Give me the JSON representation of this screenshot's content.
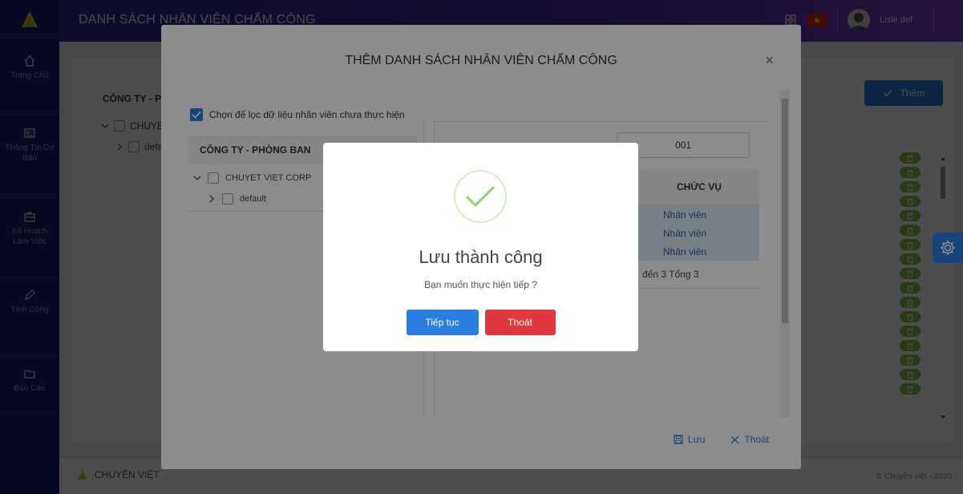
{
  "app": {
    "page_title": "DANH SÁCH NHÂN VIÊN CHẤM CÔNG",
    "user_name": "Lisle def",
    "flag_star": "★"
  },
  "sidebar": {
    "items": [
      {
        "label": "Trang Chủ",
        "icon": "home-icon"
      },
      {
        "label": "Thông Tin Cơ Bản",
        "icon": "id-card-icon"
      },
      {
        "label": "Kế Hoạch Làm Việc",
        "icon": "briefcase-icon"
      },
      {
        "label": "Tính Công",
        "icon": "pencil-icon"
      },
      {
        "label": "Báo Cáo",
        "icon": "folder-icon"
      }
    ]
  },
  "background": {
    "company_header": "CÔNG TY - PHÒ",
    "tree_root": "CHUYET",
    "tree_child": "defau",
    "add_button": "Thêm"
  },
  "footer": {
    "brand": "CHUYÊN VIỆT",
    "copyright": "© Chuyên việt - 2020"
  },
  "add_modal": {
    "title": "THÊM DANH SÁCH NHÂN VIÊN CHẤM CÔNG",
    "close_glyph": "×",
    "filter_label": "Chọn để lọc dữ liệu nhân viên chưa thực hiện",
    "left_header": "CÔNG TY - PHÒNG BAN",
    "tree_root": "CHUYET VIET CORP",
    "tree_child": "default",
    "code_value": "001",
    "position_header": "CHỨC VỤ",
    "positions": [
      "Nhân viên",
      "Nhân viên",
      "Nhân viên"
    ],
    "pager_text": "đến 3 Tổng 3",
    "save_label": "Lưu",
    "exit_label": "Thoát"
  },
  "success_dialog": {
    "title": "Lưu thành công",
    "message": "Bạn muốn thực hiện tiếp ?",
    "continue_label": "Tiếp tục",
    "exit_label": "Thoát"
  },
  "colors": {
    "sidebar": "#1a1d6e",
    "primary": "#2a7de1",
    "danger": "#e0383c",
    "success_ring": "#d3ecc4",
    "success_check": "#8fd16a"
  }
}
